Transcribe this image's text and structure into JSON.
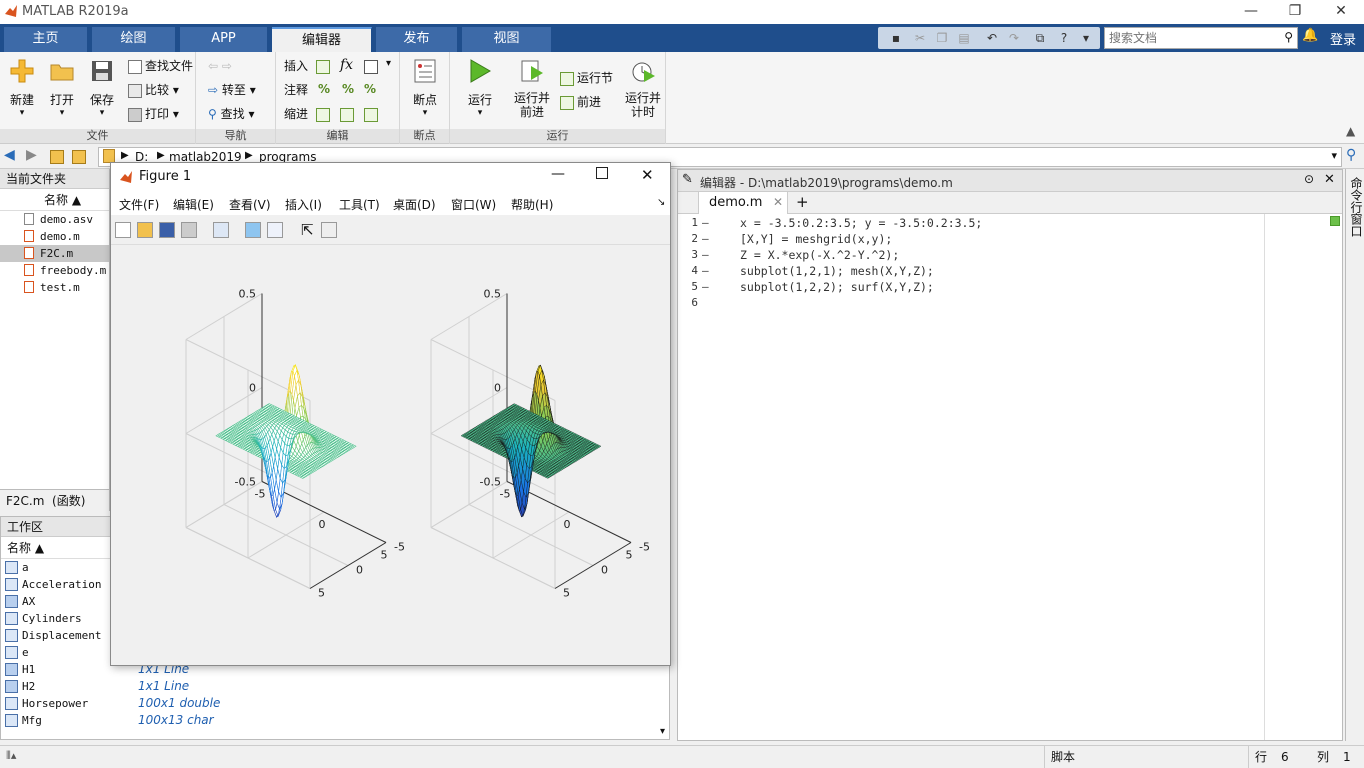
{
  "app": {
    "title": "MATLAB R2019a",
    "minimize": "—",
    "restore": "❐",
    "close": "✕"
  },
  "tabs": [
    {
      "label": "主页"
    },
    {
      "label": "绘图"
    },
    {
      "label": "APP"
    },
    {
      "label": "编辑器",
      "active": true
    },
    {
      "label": "发布"
    },
    {
      "label": "视图"
    }
  ],
  "search": {
    "placeholder": "搜索文档"
  },
  "login": "登录",
  "ribbon": {
    "file": {
      "section": "文件",
      "new": "新建",
      "open": "打开",
      "save": "保存",
      "find_files": "查找文件",
      "compare": "比较",
      "print": "打印"
    },
    "nav": {
      "section": "导航",
      "goto": "转至",
      "find": "查找"
    },
    "edit": {
      "section": "编辑",
      "insert": "插入",
      "comment": "注释",
      "indent": "缩进",
      "fx": "fx"
    },
    "breakpoints": {
      "section": "断点",
      "label": "断点"
    },
    "run": {
      "section": "运行",
      "run": "运行",
      "run_advance_1": "运行并",
      "run_advance_2": "前进",
      "run_section": "运行节",
      "advance": "前进",
      "run_time_1": "运行并",
      "run_time_2": "计时"
    }
  },
  "address": {
    "segments": [
      "D:",
      "matlab2019",
      "programs"
    ]
  },
  "filepanel": {
    "title": "当前文件夹",
    "column": "名称 ▲",
    "files": [
      "demo.asv",
      "demo.m",
      "F2C.m",
      "freebody.m",
      "test.m"
    ],
    "selected": "F2C.m",
    "details": "F2C.m  (函数)"
  },
  "workspace": {
    "title": "工作区",
    "column": "名称 ▲",
    "vars": [
      {
        "name": "a",
        "value": ""
      },
      {
        "name": "Acceleration",
        "value": ""
      },
      {
        "name": "AX",
        "value": ""
      },
      {
        "name": "Cylinders",
        "value": ""
      },
      {
        "name": "Displacement",
        "value": ""
      },
      {
        "name": "e",
        "value": ""
      },
      {
        "name": "H1",
        "value": "1x1 Line"
      },
      {
        "name": "H2",
        "value": "1x1 Line"
      },
      {
        "name": "Horsepower",
        "value": "100x1 double"
      },
      {
        "name": "Mfg",
        "value": "100x13 char"
      }
    ]
  },
  "editor": {
    "header": "编辑器 - D:\\matlab2019\\programs\\demo.m",
    "tab": "demo.m",
    "lines": [
      {
        "n": "1",
        "code": "x = -3.5:0.2:3.5; y = -3.5:0.2:3.5;"
      },
      {
        "n": "2",
        "code": "[X,Y] = meshgrid(x,y);"
      },
      {
        "n": "3",
        "code": "Z = X.*exp(-X.^2-Y.^2);"
      },
      {
        "n": "4",
        "code": "subplot(1,2,1); mesh(X,Y,Z);"
      },
      {
        "n": "5",
        "code": "subplot(1,2,2); surf(X,Y,Z);"
      },
      {
        "n": "6",
        "code": ""
      }
    ]
  },
  "cmd_side": "命令行窗口",
  "status": {
    "type": "脚本",
    "row_label": "行",
    "row": "6",
    "col_label": "列",
    "col": "1"
  },
  "figure": {
    "title": "Figure 1",
    "menu": [
      "文件(F)",
      "编辑(E)",
      "查看(V)",
      "插入(I)",
      "工具(T)",
      "桌面(D)",
      "窗口(W)",
      "帮助(H)"
    ],
    "ticks_z": [
      "0.5",
      "0",
      "-0.5"
    ],
    "ticks_x": [
      "-5",
      "0",
      "5"
    ],
    "ticks_y": [
      "-5",
      "0",
      "5"
    ]
  },
  "chart_data": [
    {
      "type": "mesh",
      "function": "Z = X.*exp(-X.^2-Y.^2)",
      "x_range": [
        -3.5,
        3.5
      ],
      "y_range": [
        -3.5,
        3.5
      ],
      "step": 0.2,
      "zlim": [
        -0.5,
        0.5
      ],
      "xlim": [
        -5,
        5
      ],
      "ylim": [
        -5,
        5
      ],
      "colormap": "parula"
    },
    {
      "type": "surf",
      "function": "Z = X.*exp(-X.^2-Y.^2)",
      "x_range": [
        -3.5,
        3.5
      ],
      "y_range": [
        -3.5,
        3.5
      ],
      "step": 0.2,
      "zlim": [
        -0.5,
        0.5
      ],
      "xlim": [
        -5,
        5
      ],
      "ylim": [
        -5,
        5
      ],
      "colormap": "parula"
    }
  ]
}
